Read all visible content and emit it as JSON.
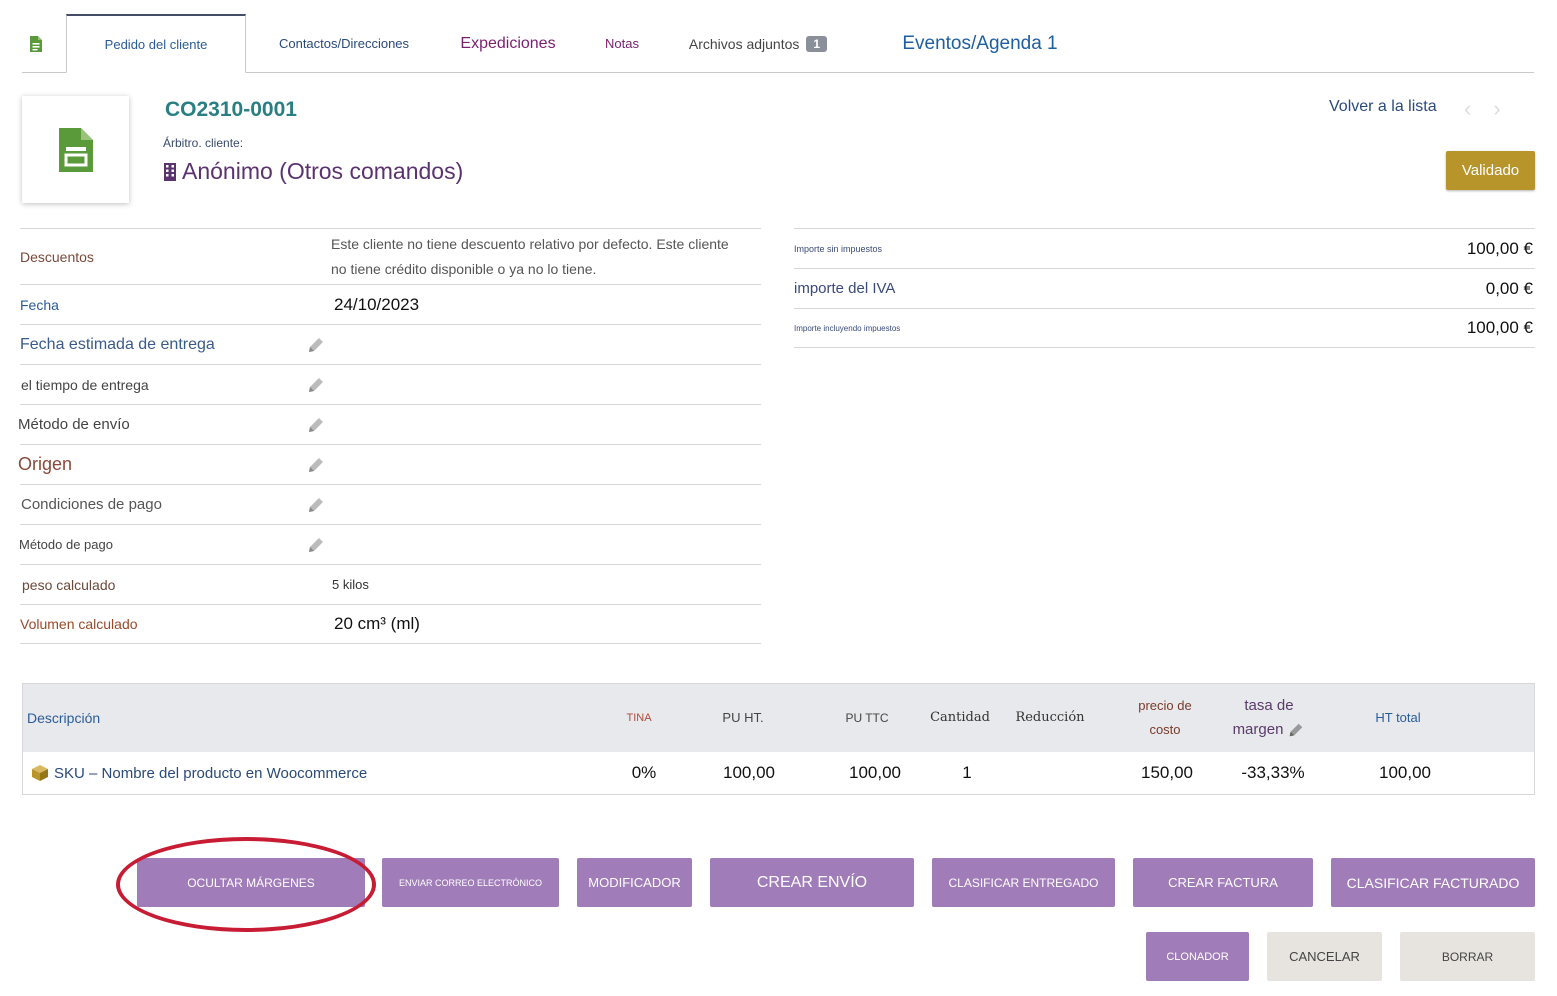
{
  "tabs": {
    "pedido": "Pedido del cliente",
    "contactos": "Contactos/Direcciones",
    "expediciones": "Expediciones",
    "notas": "Notas",
    "archivos": "Archivos adjuntos",
    "archivos_count": "1",
    "eventos": "Eventos/Agenda 1"
  },
  "header": {
    "ref": "CO2310-0001",
    "ref_client_label": "Árbitro. cliente:",
    "company": "Anónimo (Otros comandos)",
    "back_link": "Volver a la lista",
    "status": "Validado"
  },
  "fields": {
    "descuentos_label": "Descuentos",
    "descuentos_value": "Este cliente no tiene descuento relativo por defecto. Este cliente no tiene crédito disponible o ya no lo tiene.",
    "fecha_label": "Fecha",
    "fecha_value": "24/10/2023",
    "fecha_entrega_label": "Fecha estimada de entrega",
    "tiempo_entrega_label": "el tiempo de entrega",
    "metodo_envio_label": "Método de envío",
    "origen_label": "Origen",
    "condiciones_label": "Condiciones de pago",
    "metodo_pago_label": "Método de pago",
    "peso_label": "peso calculado",
    "peso_value": "5 kilos",
    "volumen_label": "Volumen calculado",
    "volumen_value": "20 cm³ (ml)"
  },
  "totals": {
    "sin_impuestos_label": "Importe sin impuestos",
    "sin_impuestos_value": "100,00 €",
    "iva_label": "importe del IVA",
    "iva_value": "0,00 €",
    "con_impuestos_label": "Importe incluyendo impuestos",
    "con_impuestos_value": "100,00 €"
  },
  "lines": {
    "headers": {
      "descripcion": "Descripción",
      "tina": "TINA",
      "pu_ht": "PU HT.",
      "pu_ttc": "PU TTC",
      "cantidad": "Cantidad",
      "reduccion": "Reducción",
      "precio_costo_1": "precio de",
      "precio_costo_2": "costo",
      "tasa_margen_1": "tasa de",
      "tasa_margen_2": "margen",
      "ht_total": "HT total"
    },
    "row": {
      "descripcion": "SKU – Nombre del producto en Woocommerce",
      "tina": "0%",
      "pu_ht": "100,00",
      "pu_ttc": "100,00",
      "cantidad": "1",
      "precio_costo": "150,00",
      "tasa_margen": "-33,33%",
      "ht_total": "100,00"
    }
  },
  "actions": {
    "ocultar": "OCULTAR MÁRGENES",
    "enviar": "ENVIAR CORREO ELECTRÓNICO",
    "modificar": "MODIFICADOR",
    "crear_envio": "CREAR ENVÍO",
    "clasificar_entregado": "CLASIFICAR ENTREGADO",
    "crear_factura": "CREAR FACTURA",
    "clasificar_facturado": "CLASIFICAR FACTURADO",
    "clonar": "CLONADOR",
    "cancelar": "CANCELAR",
    "borrar": "BORRAR"
  },
  "colors": {
    "accent_purple": "#a07cb8",
    "status_gold": "#b8952a",
    "annotation_red": "#c71c34",
    "ref_teal": "#2a7f82",
    "doc_green": "#5a9a3a"
  },
  "icons": {
    "order_tab": "document-icon",
    "thumbnail": "document-icon",
    "company": "building-icon",
    "product": "box-icon",
    "edit": "pencil-icon",
    "nav_prev": "chevron-left-icon",
    "nav_next": "chevron-right-icon"
  }
}
